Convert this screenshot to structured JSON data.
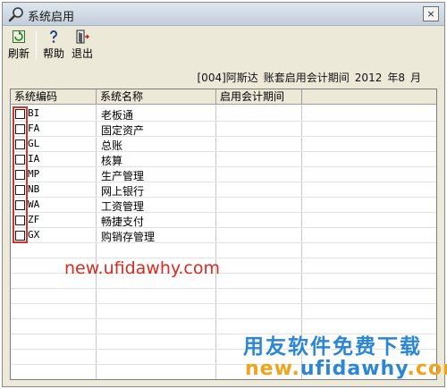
{
  "window": {
    "title": "系统启用",
    "close_label": "×"
  },
  "toolbar": {
    "refresh_label": "刷新",
    "help_label": "帮助",
    "exit_label": "退出"
  },
  "info": {
    "account": "[004]阿斯达",
    "period_label": "账套启用会计期间",
    "year": "2012",
    "year_unit": "年8",
    "month_unit": "月"
  },
  "grid": {
    "headers": [
      "系统编码",
      "系统名称",
      "启用会计期间"
    ],
    "rows": [
      {
        "code": "BI",
        "name": "老板通",
        "period": ""
      },
      {
        "code": "FA",
        "name": "固定资产",
        "period": ""
      },
      {
        "code": "GL",
        "name": "总账",
        "period": ""
      },
      {
        "code": "IA",
        "name": "核算",
        "period": ""
      },
      {
        "code": "MP",
        "name": "生产管理",
        "period": ""
      },
      {
        "code": "NB",
        "name": "网上银行",
        "period": ""
      },
      {
        "code": "WA",
        "name": "工资管理",
        "period": ""
      },
      {
        "code": "ZF",
        "name": "畅捷支付",
        "period": ""
      },
      {
        "code": "GX",
        "name": "购销存管理",
        "period": ""
      }
    ]
  },
  "watermark": {
    "url_small": "new.ufidawhy.com",
    "slogan": "用友软件免费下载",
    "url_big_prefix": "new.",
    "url_big_mid": "ufidawhy",
    "url_big_suffix": ".com"
  },
  "colors": {
    "highlight": "#d9302c",
    "watermark_red": "#d42b22",
    "watermark_blue": "#2b86d6",
    "watermark_orange": "#f1a31b"
  }
}
